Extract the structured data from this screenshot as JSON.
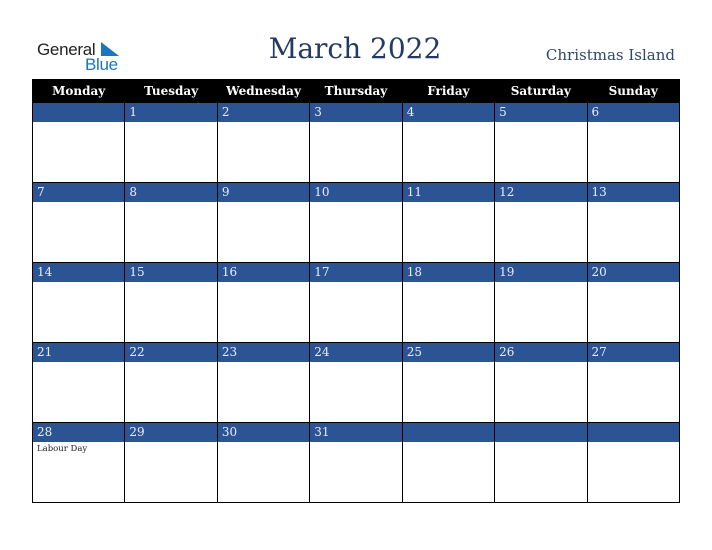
{
  "logo": {
    "line1": "General",
    "line2": "Blue",
    "accent_color": "#1a75bc"
  },
  "header": {
    "title": "March 2022",
    "region": "Christmas Island"
  },
  "colors": {
    "title": "#233a64",
    "day_band": "#2c5494",
    "header_bg": "#000000"
  },
  "weekdays": [
    "Monday",
    "Tuesday",
    "Wednesday",
    "Thursday",
    "Friday",
    "Saturday",
    "Sunday"
  ],
  "weeks": [
    {
      "days": [
        {
          "num": "",
          "event": ""
        },
        {
          "num": "1",
          "event": ""
        },
        {
          "num": "2",
          "event": ""
        },
        {
          "num": "3",
          "event": ""
        },
        {
          "num": "4",
          "event": ""
        },
        {
          "num": "5",
          "event": ""
        },
        {
          "num": "6",
          "event": ""
        }
      ]
    },
    {
      "days": [
        {
          "num": "7",
          "event": ""
        },
        {
          "num": "8",
          "event": ""
        },
        {
          "num": "9",
          "event": ""
        },
        {
          "num": "10",
          "event": ""
        },
        {
          "num": "11",
          "event": ""
        },
        {
          "num": "12",
          "event": ""
        },
        {
          "num": "13",
          "event": ""
        }
      ]
    },
    {
      "days": [
        {
          "num": "14",
          "event": ""
        },
        {
          "num": "15",
          "event": ""
        },
        {
          "num": "16",
          "event": ""
        },
        {
          "num": "17",
          "event": ""
        },
        {
          "num": "18",
          "event": ""
        },
        {
          "num": "19",
          "event": ""
        },
        {
          "num": "20",
          "event": ""
        }
      ]
    },
    {
      "days": [
        {
          "num": "21",
          "event": ""
        },
        {
          "num": "22",
          "event": ""
        },
        {
          "num": "23",
          "event": ""
        },
        {
          "num": "24",
          "event": ""
        },
        {
          "num": "25",
          "event": ""
        },
        {
          "num": "26",
          "event": ""
        },
        {
          "num": "27",
          "event": ""
        }
      ]
    },
    {
      "days": [
        {
          "num": "28",
          "event": "Labour Day"
        },
        {
          "num": "29",
          "event": ""
        },
        {
          "num": "30",
          "event": ""
        },
        {
          "num": "31",
          "event": ""
        },
        {
          "num": "",
          "event": ""
        },
        {
          "num": "",
          "event": ""
        },
        {
          "num": "",
          "event": ""
        }
      ]
    }
  ]
}
